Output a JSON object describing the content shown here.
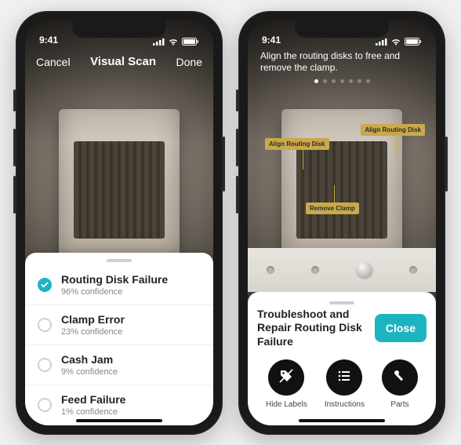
{
  "status": {
    "time": "9:41"
  },
  "phone1": {
    "nav": {
      "cancel": "Cancel",
      "title": "Visual Scan",
      "done": "Done"
    },
    "results": [
      {
        "label": "Routing Disk Failure",
        "confidence": "96% confidence",
        "selected": true
      },
      {
        "label": "Clamp Error",
        "confidence": "23% confidence",
        "selected": false
      },
      {
        "label": "Cash Jam",
        "confidence": "9% confidence",
        "selected": false
      },
      {
        "label": "Feed Failure",
        "confidence": "1% confidence",
        "selected": false
      }
    ]
  },
  "phone2": {
    "instruction": "Align the routing disks to free and remove the clamp.",
    "labels": {
      "left": "Align Routing Disk",
      "right": "Align Routing Disk",
      "bottom": "Remove Clamp"
    },
    "sheet": {
      "title": "Troubleshoot and Repair Routing Disk Failure",
      "close": "Close",
      "actions": {
        "hide": "Hide Labels",
        "instr": "Instructions",
        "parts": "Parts"
      }
    }
  },
  "colors": {
    "accent": "#1db4c1",
    "arLabel": "#c9a94a"
  }
}
